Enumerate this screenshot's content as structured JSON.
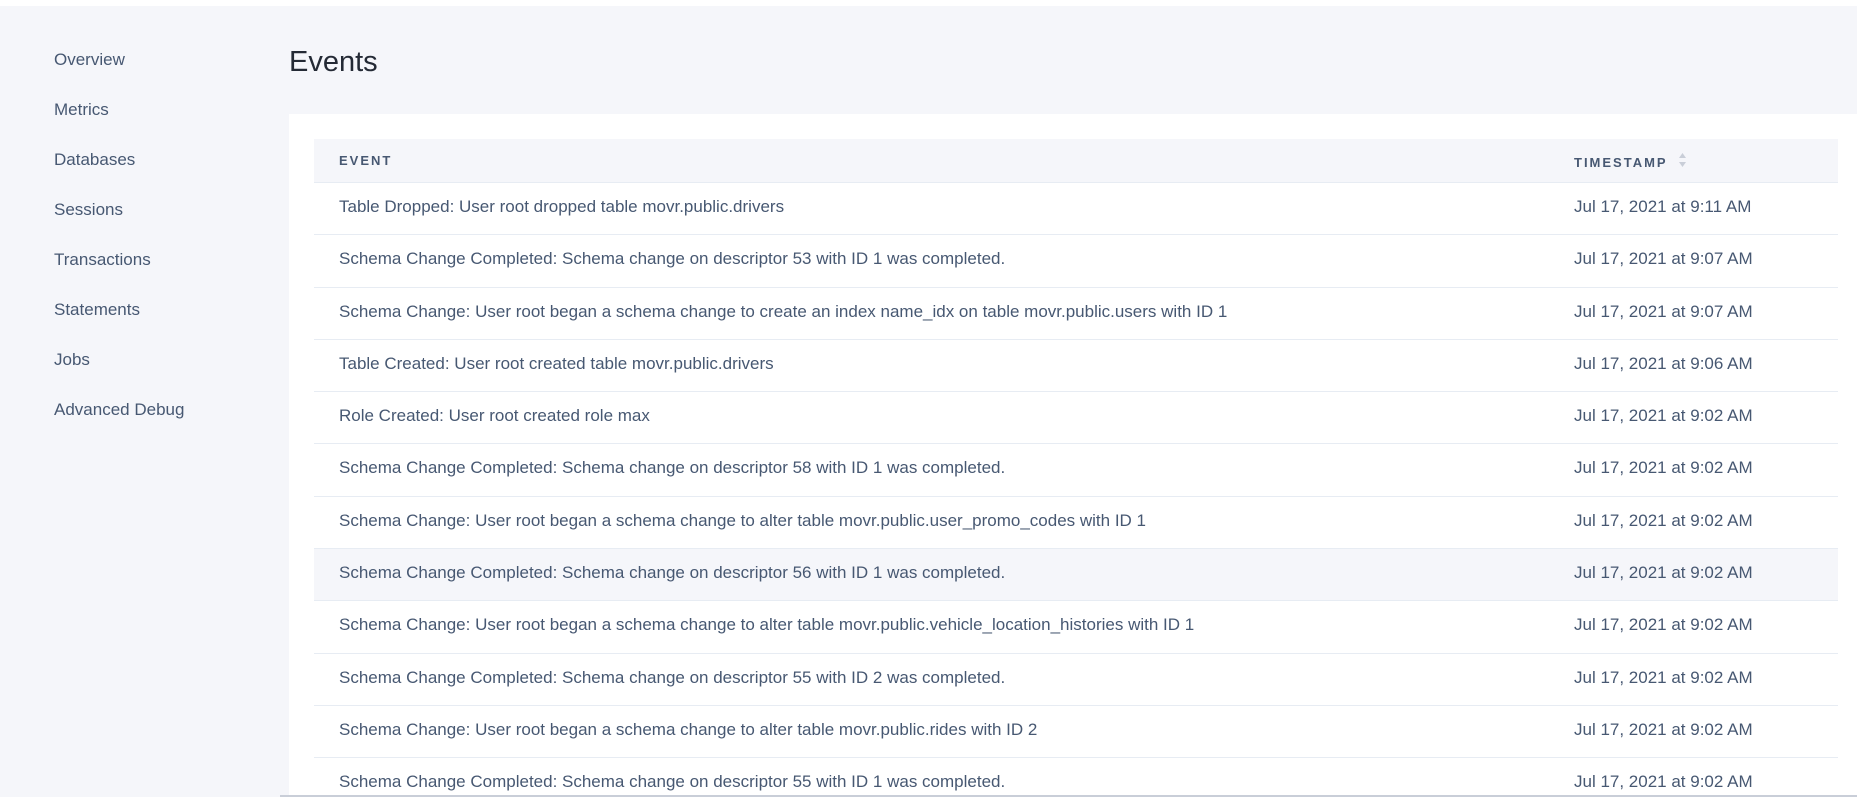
{
  "sidebar": {
    "items": [
      {
        "label": "Overview"
      },
      {
        "label": "Metrics"
      },
      {
        "label": "Databases"
      },
      {
        "label": "Sessions"
      },
      {
        "label": "Transactions"
      },
      {
        "label": "Statements"
      },
      {
        "label": "Jobs"
      },
      {
        "label": "Advanced Debug"
      }
    ]
  },
  "page": {
    "title": "Events"
  },
  "table": {
    "headers": {
      "event": "EVENT",
      "timestamp": "TIMESTAMP",
      "sort_icon": "sort-updown-icon"
    },
    "rows": [
      {
        "event": "Table Dropped: User root dropped table movr.public.drivers",
        "timestamp": "Jul 17, 2021 at 9:11 AM"
      },
      {
        "event": "Schema Change Completed: Schema change on descriptor 53 with ID 1 was completed.",
        "timestamp": "Jul 17, 2021 at 9:07 AM"
      },
      {
        "event": "Schema Change: User root began a schema change to create an index name_idx on table movr.public.users with ID 1",
        "timestamp": "Jul 17, 2021 at 9:07 AM"
      },
      {
        "event": "Table Created: User root created table movr.public.drivers",
        "timestamp": "Jul 17, 2021 at 9:06 AM"
      },
      {
        "event": "Role Created: User root created role max",
        "timestamp": "Jul 17, 2021 at 9:02 AM"
      },
      {
        "event": "Schema Change Completed: Schema change on descriptor 58 with ID 1 was completed.",
        "timestamp": "Jul 17, 2021 at 9:02 AM"
      },
      {
        "event": "Schema Change: User root began a schema change to alter table movr.public.user_promo_codes with ID 1",
        "timestamp": "Jul 17, 2021 at 9:02 AM"
      },
      {
        "event": "Schema Change Completed: Schema change on descriptor 56 with ID 1 was completed.",
        "timestamp": "Jul 17, 2021 at 9:02 AM"
      },
      {
        "event": "Schema Change: User root began a schema change to alter table movr.public.vehicle_location_histories with ID 1",
        "timestamp": "Jul 17, 2021 at 9:02 AM"
      },
      {
        "event": "Schema Change Completed: Schema change on descriptor 55 with ID 2 was completed.",
        "timestamp": "Jul 17, 2021 at 9:02 AM"
      },
      {
        "event": "Schema Change: User root began a schema change to alter table movr.public.rides with ID 2",
        "timestamp": "Jul 17, 2021 at 9:02 AM"
      },
      {
        "event": "Schema Change Completed: Schema change on descriptor 55 with ID 1 was completed.",
        "timestamp": "Jul 17, 2021 at 9:02 AM"
      }
    ]
  },
  "colors": {
    "background": "#f5f6fa",
    "panel": "#ffffff",
    "text": "#475872",
    "title": "#242a35",
    "divider": "#e7ecf3"
  }
}
